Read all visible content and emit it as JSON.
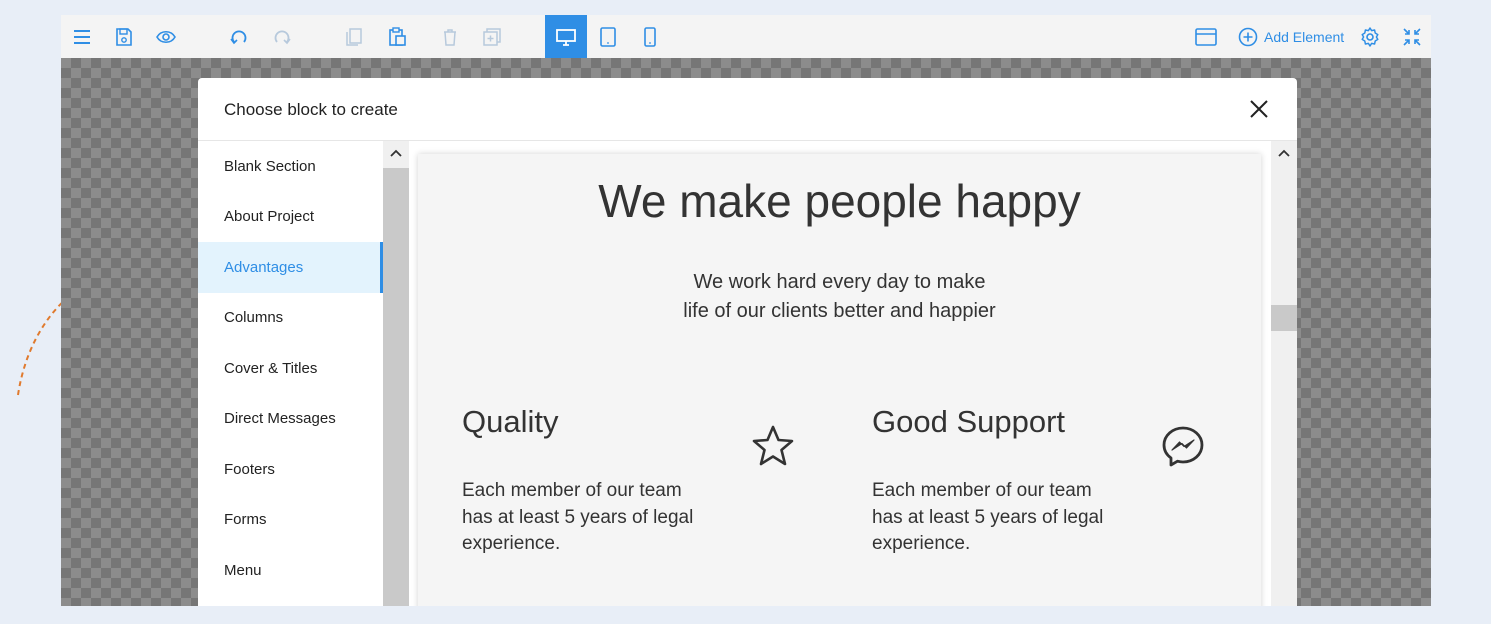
{
  "toolbar": {
    "add_element_label": "Add Element",
    "accent_color": "#2f8ee5"
  },
  "modal": {
    "title": "Choose block to create",
    "categories": [
      {
        "label": "Blank Section"
      },
      {
        "label": "About Project"
      },
      {
        "label": "Advantages",
        "active": true
      },
      {
        "label": "Columns"
      },
      {
        "label": "Cover & Titles"
      },
      {
        "label": "Direct Messages"
      },
      {
        "label": "Footers"
      },
      {
        "label": "Forms"
      },
      {
        "label": "Menu"
      }
    ]
  },
  "preview": {
    "headline": "We make people happy",
    "subline_1": "We work hard every day to make",
    "subline_2": "life of our clients better and happier",
    "features": [
      {
        "title": "Quality",
        "text": "Each member of our team has at least 5 years of legal experience.",
        "icon": "star-icon"
      },
      {
        "title": "Good Support",
        "text": "Each member of our team has at least 5 years of legal experience.",
        "icon": "messenger-icon"
      }
    ]
  }
}
